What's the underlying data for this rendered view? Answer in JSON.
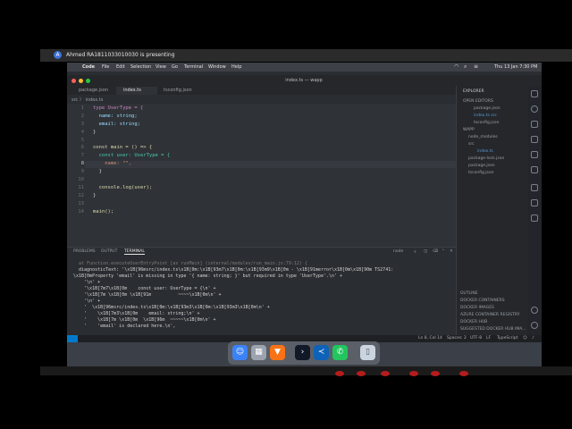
{
  "presenter": {
    "avatar": "A",
    "text": "Ahmed RA1811033010030 is presenting"
  },
  "menubar": {
    "apple": "",
    "items": [
      "Code",
      "File",
      "Edit",
      "Selection",
      "View",
      "Go",
      "Terminal",
      "Window",
      "Help"
    ],
    "clock": "Thu 13 Jan 7:30 PM"
  },
  "window": {
    "title": "index.ts — wapp"
  },
  "tabs": [
    {
      "label": "package.json"
    },
    {
      "label": "index.ts"
    },
    {
      "label": "tsconfig.json"
    }
  ],
  "breadcrumb": "src 〉 index.ts",
  "editor": {
    "line_numbers": [
      "1",
      "2",
      "3",
      "4",
      "5",
      "6",
      "7",
      "8",
      "9",
      "10",
      "11",
      "12",
      "13",
      "14"
    ],
    "lines": [
      "type UserType = {",
      "  name: string;",
      "  email: string;",
      "}",
      "",
      "const main = () => {",
      "  const user: UserType = {",
      "    name: \"\",",
      "  }",
      "",
      "  console.log(user);",
      "}",
      "",
      "main();"
    ]
  },
  "panel": {
    "tabs": [
      "PROBLEMS",
      "OUTPUT",
      "TERMINAL"
    ],
    "shell": "node",
    "terminal_lines": [
      "  at Function.executeUserEntryPoint [as runMain] (internal/modules/run_main.js:79:12) {",
      "  diagnosticText: '\\x1B[96msrc/index.ts\\x1B[0m:\\x1B[93m7\\x1B[0m:\\x1B[93m9\\x1B[0m - \\x1B[91merror\\x1B[0m\\x1B[90m TS2741:",
      "\\x1B[0mProperty 'email' is missing in type '{ name: string; }' but required in type 'UserType'.\\n' +",
      "    '\\n' +",
      "    '\\x1B[7m7\\x1B[0m    const user: UserType = {\\n' +",
      "    '\\x1B[7m \\x1B[0m \\x1B[91m          ~~~~\\x1B[0m\\n' +",
      "    '\\n' +",
      "    '  \\x1B[96msrc/index.ts\\x1B[0m:\\x1B[93m3\\x1B[0m:\\x1B[93m3\\x1B[0m\\n' +",
      "    '    \\x1B[7m3\\x1B[0m    email: string;\\n' +",
      "    '    \\x1B[7m \\x1B[0m  \\x1B[96m  ~~~~~\\x1B[0m\\n' +",
      "    '    'email' is declared here.\\n',"
    ]
  },
  "explorer": {
    "header": "EXPLORER",
    "open_editors": "OPEN EDITORS",
    "open_files": [
      "package.json",
      "index.ts src",
      "tsconfig.json"
    ],
    "project": "WAPP",
    "tree": [
      "node_modules",
      "src",
      "index.ts",
      "package-lock.json",
      "package.json",
      "tsconfig.json"
    ],
    "bottom_sections": [
      "OUTLINE",
      "DOCKER CONTAINERS",
      "DOCKER IMAGES",
      "AZURE CONTAINER REGISTRY",
      "DOCKER HUB",
      "SUGGESTED DOCKER HUB IMA..."
    ]
  },
  "statusbar": {
    "position": "Ln 8, Col 14",
    "spaces": "Spaces: 2",
    "encoding": "UTF-8",
    "eol": "LF",
    "language": "TypeScript"
  },
  "dock": {
    "apps": [
      "Finder",
      "Launchpad",
      "Brave",
      "Terminal",
      "VS Code",
      "WhatsApp",
      "Trash"
    ]
  },
  "colors": {
    "accent": "#007acc",
    "editor_bg": "#2f3237",
    "recording_red": "#b51c1c"
  }
}
